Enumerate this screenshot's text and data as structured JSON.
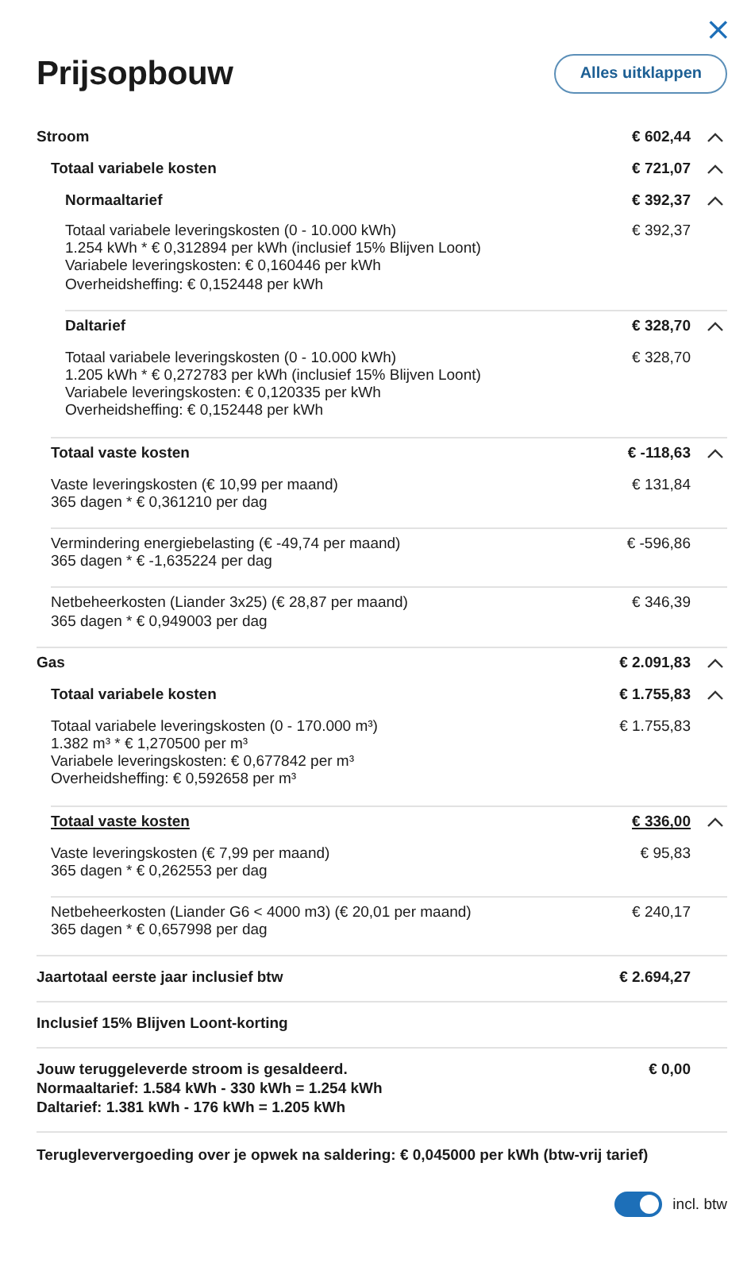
{
  "close_label": "×",
  "title": "Prijsopbouw",
  "expand_all_button": "Alles uitklappen",
  "breakdown": [
    {
      "kind": "group",
      "label": "Stroom",
      "amount": "€ 602,44",
      "expanded": true,
      "underlined": false,
      "children": [
        {
          "kind": "group",
          "label": "Totaal variabele kosten",
          "amount": "€ 721,07",
          "expanded": true,
          "underlined": false,
          "children": [
            {
              "kind": "group",
              "label": "Normaaltarief",
              "amount": "€ 392,37",
              "expanded": true,
              "underlined": false,
              "children": [
                {
                  "kind": "line",
                  "lines": [
                    "Totaal variabele leveringskosten (0 - 10.000 kWh)",
                    "1.254 kWh * € 0,312894 per kWh (inclusief 15% Blijven Loont)",
                    "Variabele leveringskosten: € 0,160446 per kWh",
                    "Overheidsheffing: € 0,152448 per kWh"
                  ],
                  "amount": "€ 392,37"
                }
              ]
            },
            {
              "kind": "group",
              "label": "Daltarief",
              "amount": "€ 328,70",
              "expanded": true,
              "underlined": false,
              "children": [
                {
                  "kind": "line",
                  "lines": [
                    "Totaal variabele leveringskosten (0 - 10.000 kWh)",
                    "1.205 kWh * € 0,272783 per kWh (inclusief 15% Blijven Loont)",
                    "Variabele leveringskosten: € 0,120335 per kWh",
                    "Overheidsheffing: € 0,152448 per kWh"
                  ],
                  "amount": "€ 328,70"
                }
              ]
            }
          ]
        },
        {
          "kind": "group",
          "label": "Totaal vaste kosten",
          "amount": "€ -118,63",
          "expanded": true,
          "underlined": false,
          "children": [
            {
              "kind": "line",
              "lines": [
                "Vaste leveringskosten (€ 10,99 per maand)",
                "365 dagen * € 0,361210 per dag"
              ],
              "amount": "€ 131,84"
            },
            {
              "kind": "line",
              "lines": [
                "Vermindering energiebelasting (€ -49,74 per maand)",
                "365 dagen * € -1,635224 per dag"
              ],
              "amount": "€ -596,86"
            },
            {
              "kind": "line",
              "lines": [
                "Netbeheerkosten (Liander 3x25) (€ 28,87 per maand)",
                "365 dagen * € 0,949003 per dag"
              ],
              "amount": "€ 346,39"
            }
          ]
        }
      ]
    },
    {
      "kind": "group",
      "label": "Gas",
      "amount": "€ 2.091,83",
      "expanded": true,
      "underlined": false,
      "children": [
        {
          "kind": "group",
          "label": "Totaal variabele kosten",
          "amount": "€ 1.755,83",
          "expanded": true,
          "underlined": false,
          "children": [
            {
              "kind": "line",
              "lines": [
                "Totaal variabele leveringskosten (0 - 170.000 m³)",
                "1.382 m³ * € 1,270500 per m³",
                "Variabele leveringskosten: € 0,677842 per m³",
                "Overheidsheffing: € 0,592658 per m³"
              ],
              "amount": "€ 1.755,83"
            }
          ]
        },
        {
          "kind": "group",
          "label": "Totaal vaste kosten",
          "amount": "€ 336,00",
          "expanded": true,
          "underlined": true,
          "children": [
            {
              "kind": "line",
              "lines": [
                "Vaste leveringskosten (€ 7,99 per maand)",
                "365 dagen * € 0,262553 per dag"
              ],
              "amount": "€ 95,83"
            },
            {
              "kind": "line",
              "lines": [
                "Netbeheerkosten (Liander G6 < 4000 m3) (€ 20,01 per maand)",
                "365 dagen * € 0,657998 per dag"
              ],
              "amount": "€ 240,17"
            }
          ]
        }
      ]
    }
  ],
  "summary": [
    {
      "lines": [
        "Jaartotaal eerste jaar inclusief btw"
      ],
      "amount": "€ 2.694,27"
    },
    {
      "lines": [
        "Inclusief 15% Blijven Loont-korting"
      ]
    },
    {
      "lines": [
        "Jouw teruggeleverde stroom is gesaldeerd.",
        "Normaaltarief: 1.584 kWh - 330 kWh = 1.254 kWh",
        "Daltarief: 1.381 kWh - 176 kWh = 1.205 kWh"
      ],
      "amount": "€ 0,00"
    }
  ],
  "note": "Terugleververgoeding over je opwek na saldering: € 0,045000 per kWh (btw-vrij tarief)",
  "vat_toggle": {
    "label": "incl. btw",
    "on": true
  }
}
